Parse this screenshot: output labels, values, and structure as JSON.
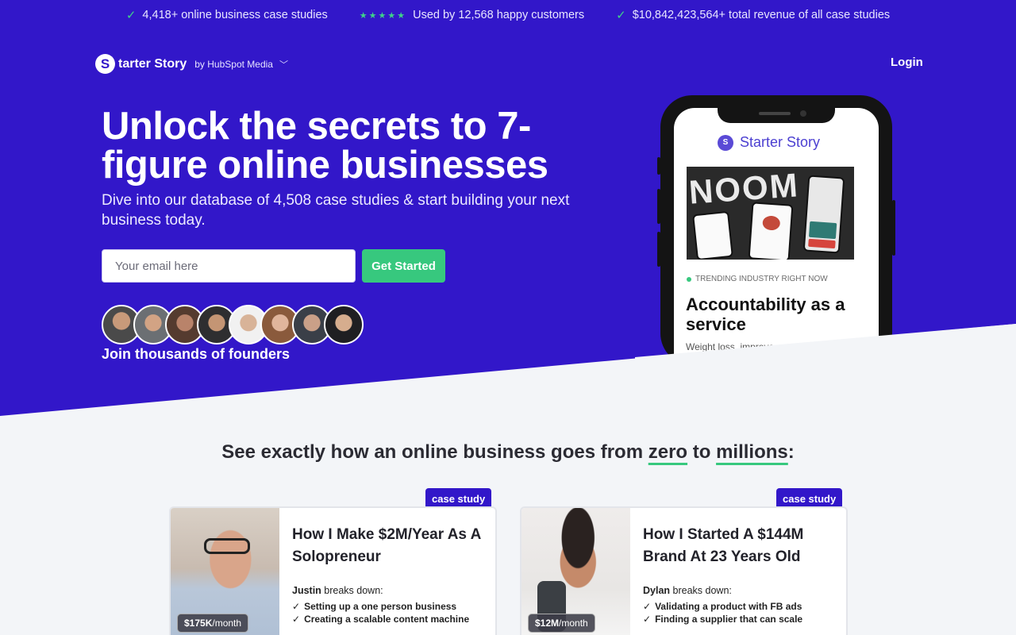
{
  "topbar": {
    "items": [
      {
        "icon": "check-icon",
        "text": "4,418+ online business case studies"
      },
      {
        "icon": "stars-icon",
        "stars": "★★★★★",
        "text": "Used by 12,568 happy customers"
      },
      {
        "icon": "check-icon",
        "text": "$10,842,423,564+ total revenue of all case studies"
      }
    ]
  },
  "nav": {
    "logo_letter": "S",
    "brand": "tarter Story",
    "by": "by HubSpot Media",
    "login": "Login"
  },
  "hero": {
    "headline": "Unlock the secrets to 7-figure online businesses",
    "subhead": "Dive into our database of 4,508 case studies & start building your next business today.",
    "email_placeholder": "Your email here",
    "cta": "Get Started",
    "join": "Join thousands of founders"
  },
  "phone": {
    "logo_letter": "S",
    "brand": "Starter Story",
    "image_word": "NOOM",
    "trend_label": "TRENDING INDUSTRY RIGHT NOW",
    "title": "Accountability as a service",
    "desc": "Weight loss, improve..."
  },
  "section": {
    "title_pre": "See exactly how an online business goes from ",
    "zero": "zero",
    "mid": " to ",
    "millions": "millions",
    "end": ":"
  },
  "cards": [
    {
      "tag": "case study",
      "title": "How I Make $2M/Year As A Solopreneur",
      "founder": "Justin",
      "breaks": " breaks down:",
      "points": [
        "Setting up a one person business",
        "Creating a scalable content machine"
      ],
      "revenue": "$175K",
      "revenue_unit": "/month"
    },
    {
      "tag": "case study",
      "title": "How I Started A $144M Brand At 23 Years Old",
      "founder": "Dylan",
      "breaks": " breaks down:",
      "points": [
        "Validating a product with FB ads",
        "Finding a supplier that can scale"
      ],
      "revenue": "$12M",
      "revenue_unit": "/month"
    }
  ],
  "colors": {
    "hero_bg": "#3217c9",
    "accent_green": "#37c87e",
    "page_bg": "#f3f5f8"
  }
}
